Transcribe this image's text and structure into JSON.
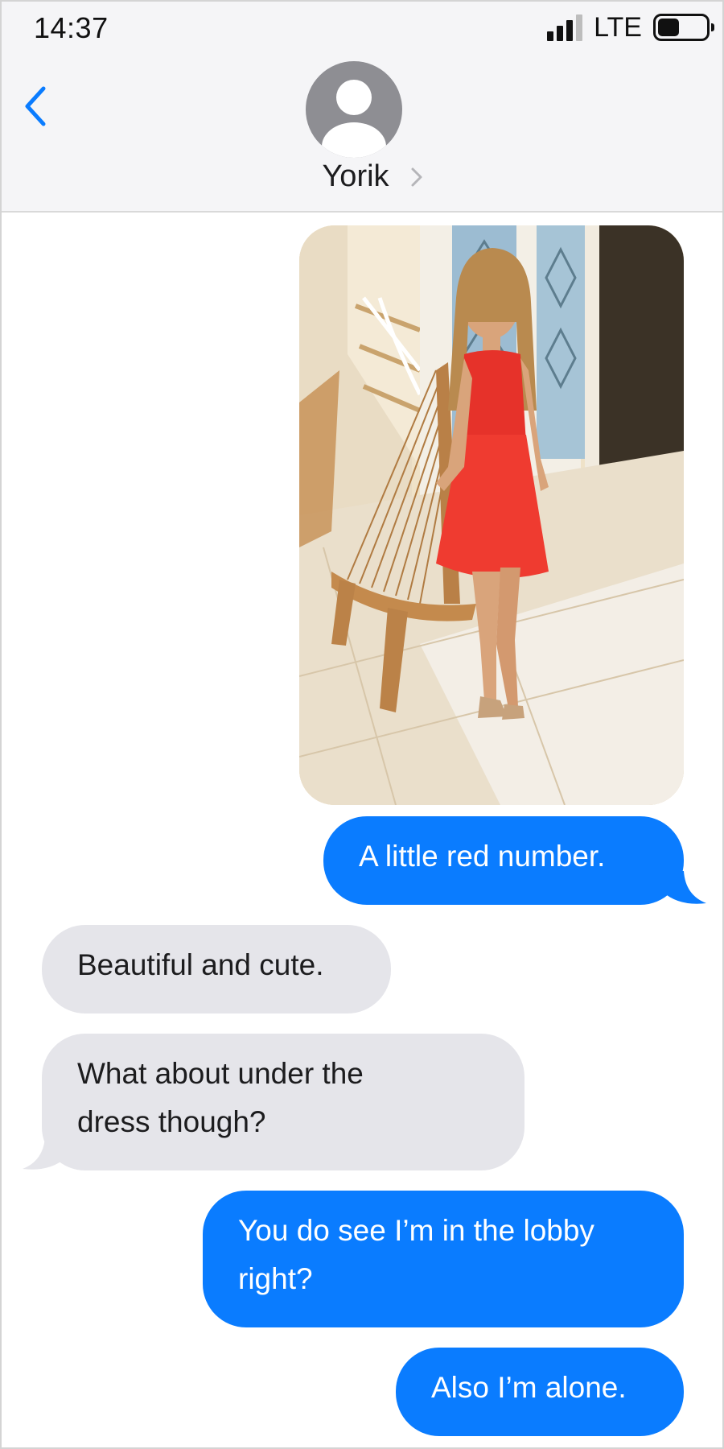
{
  "status_bar": {
    "time": "14:37",
    "network": "LTE",
    "signal_bars": 3,
    "signal_bars_total": 4,
    "battery_level": 0.45,
    "icons": [
      "signal-icon",
      "battery-icon"
    ]
  },
  "header": {
    "contact_name": "Yorik",
    "icons": [
      "back-chevron-icon",
      "contact-avatar-icon",
      "chevron-right-icon"
    ]
  },
  "colors": {
    "outgoing_bubble": "#0a7cff",
    "incoming_bubble": "#e5e5ea",
    "accent": "#0a7cff",
    "header_background": "#f5f5f7"
  },
  "messages": [
    {
      "direction": "outgoing",
      "type": "photo"
    },
    {
      "direction": "outgoing",
      "type": "text",
      "text": "A little red number."
    },
    {
      "direction": "incoming",
      "type": "text",
      "text": "Beautiful and cute."
    },
    {
      "direction": "incoming",
      "type": "text",
      "lines": [
        "What about under the",
        "dress though?"
      ]
    },
    {
      "direction": "outgoing",
      "type": "text",
      "lines": [
        "You do see I’m in the lobby",
        "right?"
      ]
    },
    {
      "direction": "outgoing",
      "type": "text",
      "text": "Also I’m alone."
    }
  ]
}
